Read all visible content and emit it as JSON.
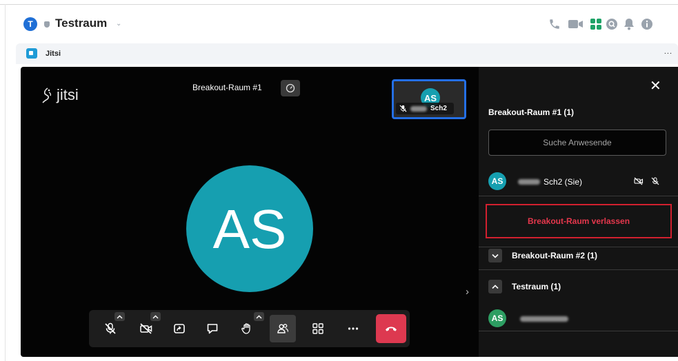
{
  "room": {
    "avatar_letter": "T",
    "name": "Testraum"
  },
  "header_icons": [
    "phone-icon",
    "video-icon",
    "apps-grid-icon",
    "search-icon",
    "bell-icon",
    "info-icon"
  ],
  "widget": {
    "title": "Jitsi",
    "more": "..."
  },
  "jitsi": {
    "logo_text": "jitsi",
    "room_title": "Breakout-Raum #1",
    "thumbnail": {
      "initials": "AS",
      "name": "Sch2"
    },
    "main_avatar": "AS",
    "toolbar": [
      "microphone-muted",
      "camera-off",
      "share-screen",
      "chat",
      "raise-hand",
      "participants",
      "tile-view",
      "more",
      "hangup"
    ]
  },
  "panel": {
    "heading": "Breakout-Raum #1 (1)",
    "search_placeholder": "Suche Anwesende",
    "participant": {
      "initials": "AS",
      "name": "Sch2 (Sie)"
    },
    "leave_label": "Breakout-Raum verlassen",
    "rooms": [
      {
        "label": "Breakout-Raum #2 (1)",
        "expanded": false
      },
      {
        "label": "Testraum (1)",
        "expanded": true
      }
    ],
    "other_participant": {
      "initials": "AS"
    }
  },
  "colors": {
    "accent_teal": "#169fb0",
    "leave_red": "#e5374c",
    "hangup": "#dd3950",
    "highlight_blue": "#246fe5",
    "grid_green": "#1fa368"
  }
}
